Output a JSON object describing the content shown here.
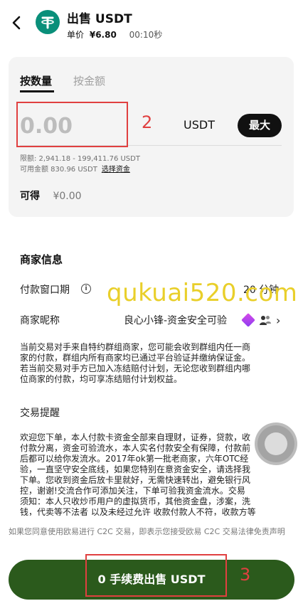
{
  "header": {
    "title": "出售 USDT",
    "price_label": "单价",
    "price_value": "¥6.80",
    "timer": "00:10秒"
  },
  "order": {
    "tabs": [
      "按数量",
      "按金额"
    ],
    "amount_placeholder": "0.00",
    "unit": "USDT",
    "max_label": "最大",
    "limits": "限额: 2,941.18 - 199,411.76 USDT",
    "available_label": "可用金额 830.96 USDT",
    "select_funds_label": "选择资金",
    "receive_label": "可得",
    "receive_value": "¥0.00"
  },
  "merchant": {
    "section_title": "商家信息",
    "payment_window_label": "付款窗口期",
    "payment_window_value": "20 分钟",
    "nickname_label": "商家昵称",
    "nickname_value": "良心小锋-资金安全可验",
    "notice_lines": [
      "当前交易对手来自特约群组商家，您可能会收到群组内任一商",
      "家的付款，群组内所有商家均已通过平台验证并缴纳保证金。",
      "若当前交易对手方已加入冻结赔付计划，无论您收到群组内哪",
      "位商家的付款，均可享冻结赔付计划权益。"
    ]
  },
  "reminder": {
    "title": "交易提醒",
    "lines": [
      "欢迎您下单，本人付款卡资金全部来自理财，证券，贷款，收",
      "付款分离，资金可验流水，本人实名付款安全有保障，付款前",
      "后都可以给你发流水。2017年ok第一批老商家，六年OTC经",
      "验，一直坚守安全底线，如果您特别在意资金安全，请选择我",
      "下单。您收到资金后放卡里就好，无需快速转出，避免银行风",
      "控，谢谢!交流合作可添加关注，下单可验我资金流水。交易",
      "须知：本人只收炒币用户的虚拟货币，其他资金盘，涉案，洗",
      "钱，代卖等不法者 以及未经过允许 收款付款人不符，收款方等"
    ]
  },
  "footer": {
    "disclaimer": "如果您同意使用欧易进行 C2C 交易，即表示您接受欧易 C2C 交易法律免责声明",
    "sell_button": "0 手续费出售 USDT"
  },
  "annotations": {
    "marker_2": "2",
    "marker_3": "3",
    "color": "#e04040"
  },
  "watermark": "qukuai520.com",
  "colors": {
    "brand_green": "#2b5a1c",
    "tether": "#0a8f7a"
  }
}
